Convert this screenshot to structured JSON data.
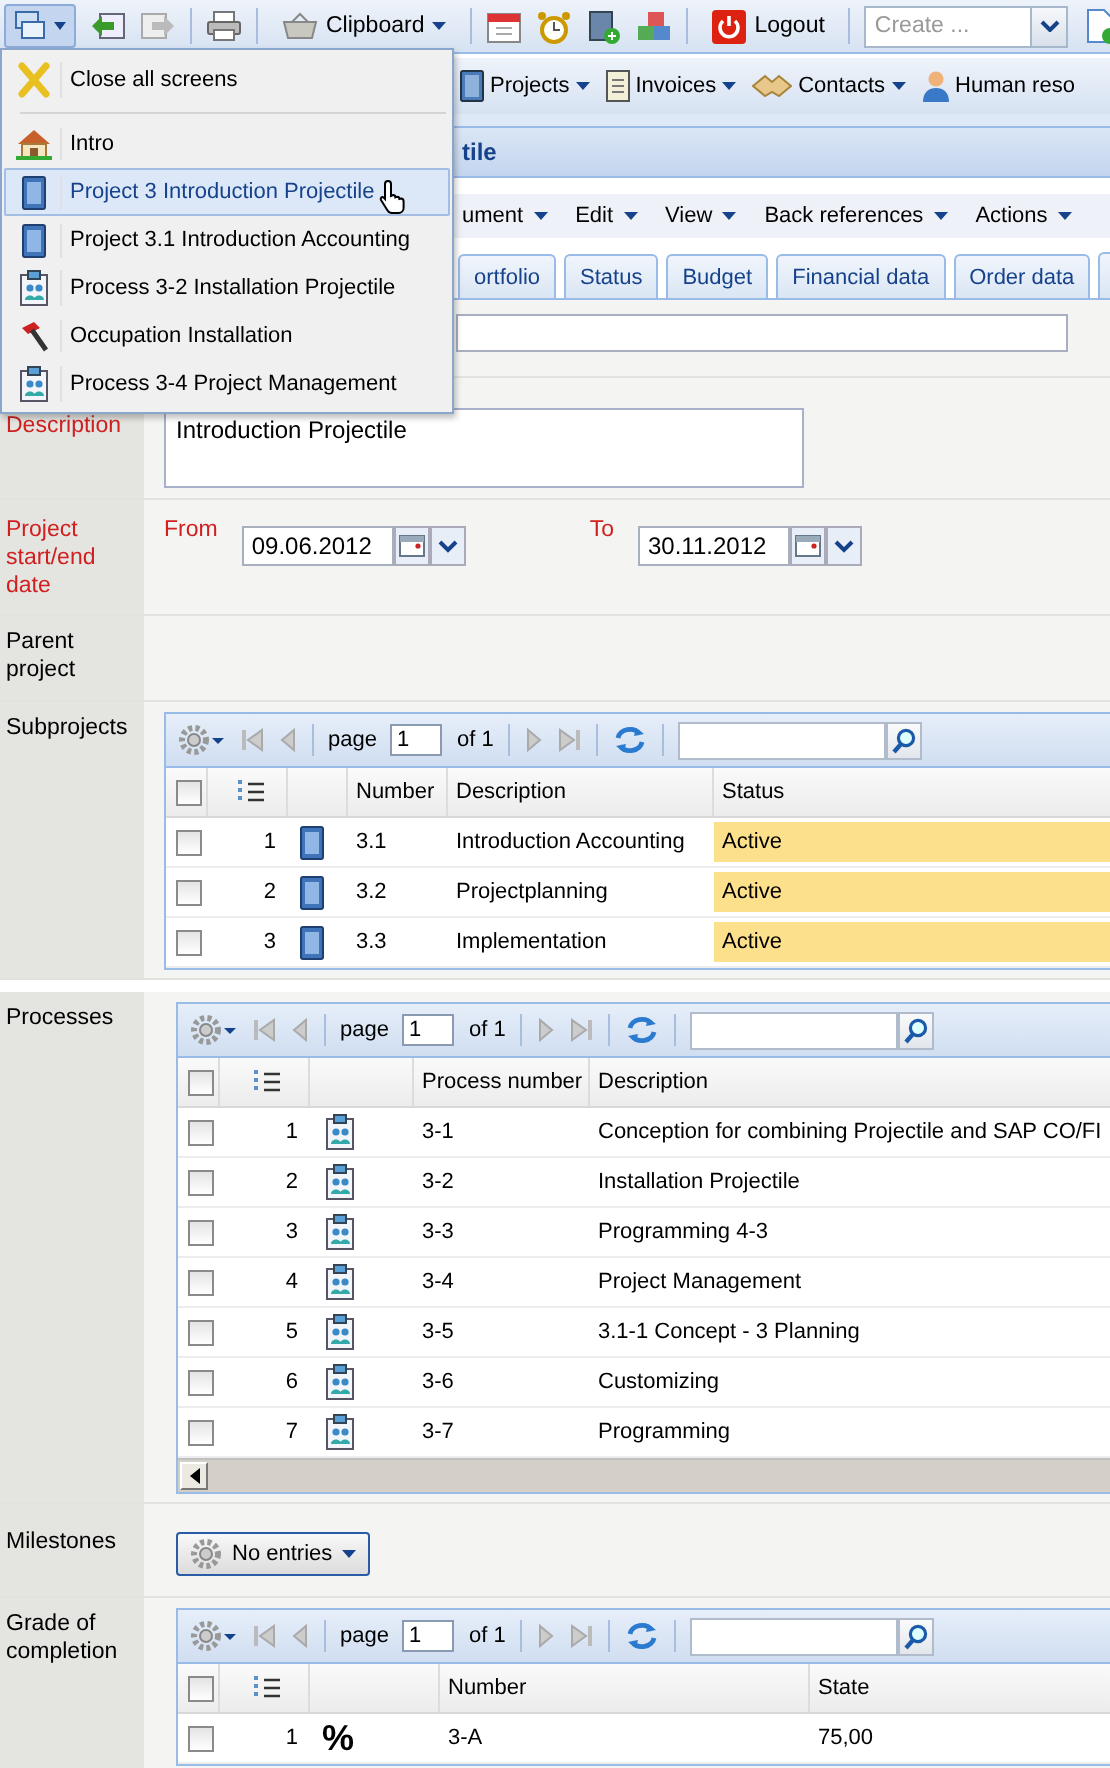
{
  "toolbar": {
    "clipboard": "Clipboard",
    "logout": "Logout",
    "create_placeholder": "Create ..."
  },
  "navigation": [
    {
      "label": "Projects",
      "kind": "project",
      "caret": true
    },
    {
      "label": "Invoices",
      "kind": "invoice",
      "caret": true
    },
    {
      "label": "Contacts",
      "kind": "contacts",
      "caret": true
    },
    {
      "label": "Human reso",
      "kind": "person",
      "caret": false
    }
  ],
  "screens_menu": [
    {
      "label": "Close all screens",
      "kind": "close",
      "selected": false
    },
    {
      "label": "Intro",
      "kind": "home",
      "selected": false
    },
    {
      "label": "Project 3 Introduction Projectile",
      "kind": "project",
      "selected": true
    },
    {
      "label": "Project 3.1 Introduction Accounting",
      "kind": "project",
      "selected": false
    },
    {
      "label": "Process 3-2 Installation Projectile",
      "kind": "process",
      "selected": false
    },
    {
      "label": "Occupation Installation",
      "kind": "occupation",
      "selected": false
    },
    {
      "label": "Process 3-4 Project Management",
      "kind": "process",
      "selected": false
    }
  ],
  "title": "tile",
  "menu": [
    "ument",
    "Edit",
    "View",
    "Back references",
    "Actions"
  ],
  "tabs": [
    {
      "label": "ortfolio",
      "selected": false
    },
    {
      "label": "Status",
      "selected": false
    },
    {
      "label": "Budget",
      "selected": false
    },
    {
      "label": "Financial data",
      "selected": false
    },
    {
      "label": "Order data",
      "selected": false
    }
  ],
  "form": [
    {
      "kind": "text"
    },
    {
      "kind": "textarea",
      "label": "Description",
      "required": true,
      "value": "Introduction Projectile"
    },
    {
      "kind": "dates",
      "label": "Project start/end date",
      "required": true,
      "from_label": "From",
      "from": "09.06.2012",
      "to_label": "To",
      "to": "30.11.2012"
    },
    {
      "kind": "empty",
      "label": "Parent project",
      "required": false
    },
    {
      "kind": "grid",
      "label": "Subprojects",
      "required": false,
      "grid": {
        "page_label": "page",
        "page": "1",
        "of": "of 1",
        "scrollbar": false,
        "all_checked": false,
        "columns": [
          {
            "label": "Number",
            "highlighted": false
          },
          {
            "label": "Description",
            "highlighted": false
          },
          {
            "label": "Status",
            "highlighted": true
          }
        ],
        "rows": [
          {
            "number": "1",
            "kind": "project",
            "checked": false,
            "cells": [
              "3.1",
              "Introduction Accounting",
              "Active"
            ]
          },
          {
            "number": "2",
            "kind": "project",
            "checked": false,
            "cells": [
              "3.2",
              "Projectplanning",
              "Active"
            ]
          },
          {
            "number": "3",
            "kind": "project",
            "checked": false,
            "cells": [
              "3.3",
              "Implementation",
              "Active"
            ]
          }
        ]
      }
    },
    {
      "kind": "break"
    },
    {
      "kind": "grid",
      "label": "Processes",
      "required": false,
      "grid": {
        "page_label": "page",
        "page": "1",
        "of": "of 1",
        "scrollbar": true,
        "all_checked": false,
        "columns": [
          {
            "label": "Process number",
            "highlighted": false
          },
          {
            "label": "Description",
            "highlighted": false
          }
        ],
        "rows": [
          {
            "number": "1",
            "kind": "process",
            "checked": false,
            "cells": [
              "3-1",
              "Conception for combining Projectile and SAP CO/FI"
            ]
          },
          {
            "number": "2",
            "kind": "process",
            "checked": false,
            "cells": [
              "3-2",
              "Installation Projectile"
            ]
          },
          {
            "number": "3",
            "kind": "process",
            "checked": false,
            "cells": [
              "3-3",
              "Programming 4-3"
            ]
          },
          {
            "number": "4",
            "kind": "process",
            "checked": false,
            "cells": [
              "3-4",
              "Project Management"
            ]
          },
          {
            "number": "5",
            "kind": "process",
            "checked": false,
            "cells": [
              "3-5",
              "3.1-1 Concept - 3 Planning"
            ]
          },
          {
            "number": "6",
            "kind": "process",
            "checked": false,
            "cells": [
              "3-6",
              "Customizing"
            ]
          },
          {
            "number": "7",
            "kind": "process",
            "checked": false,
            "cells": [
              "3-7",
              "Programming"
            ]
          }
        ]
      }
    },
    {
      "kind": "menu_button",
      "label": "Milestones",
      "required": false,
      "button": "No entries"
    },
    {
      "kind": "grid",
      "label": "Grade of completion",
      "required": false,
      "grid": {
        "page_label": "page",
        "page": "1",
        "of": "of 1",
        "scrollbar": false,
        "all_checked": false,
        "columns": [
          {
            "label": "Number",
            "highlighted": false
          },
          {
            "label": "State",
            "highlighted": false
          }
        ],
        "rows": [
          {
            "number": "1",
            "kind": "percent",
            "symbol": "%",
            "checked": false,
            "cells": [
              "3-A",
              "75,00"
            ]
          }
        ]
      }
    }
  ]
}
